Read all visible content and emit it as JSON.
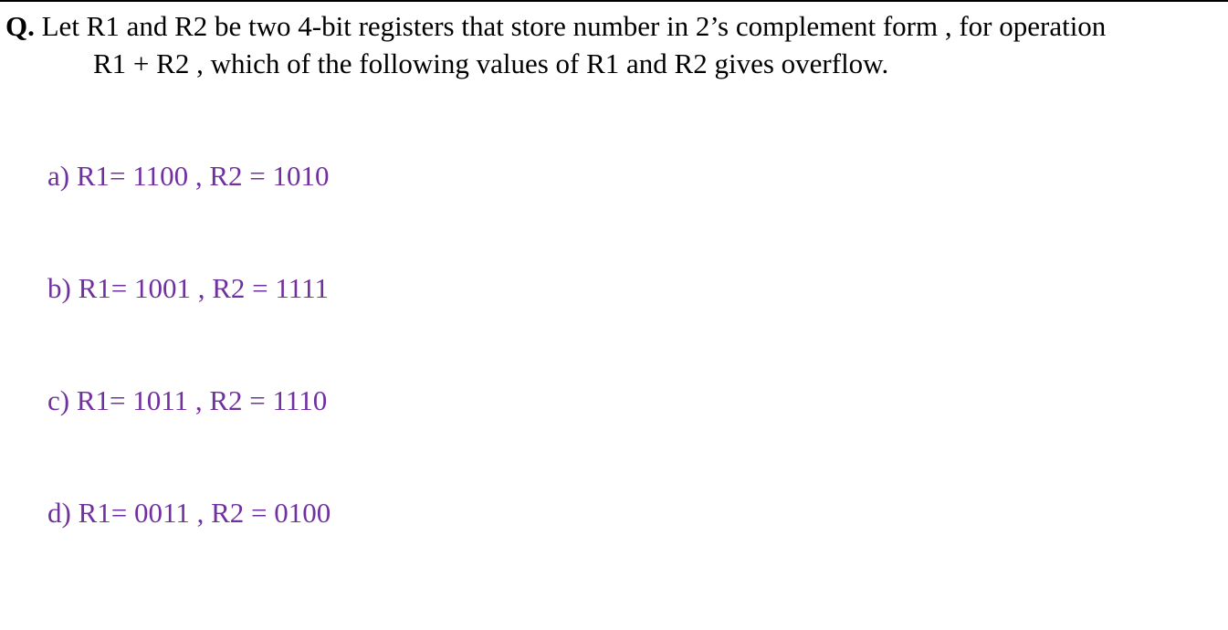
{
  "question": {
    "prefix": "Q.",
    "line1": " Let R1 and R2 be two 4-bit registers that store number in 2’s complement form , for operation",
    "line2": "R1 + R2 , which of the following values of R1 and R2 gives overflow."
  },
  "options": [
    {
      "text": "a) R1= 1100 , R2 = 1010"
    },
    {
      "text": "b) R1= 1001 , R2 = 1111"
    },
    {
      "text": "c) R1= 1011 , R2 = 1110"
    },
    {
      "text": "d) R1= 0011 , R2 = 0100"
    }
  ],
  "colors": {
    "question_text": "#000000",
    "option_text": "#7030A0",
    "rule": "#000000"
  }
}
